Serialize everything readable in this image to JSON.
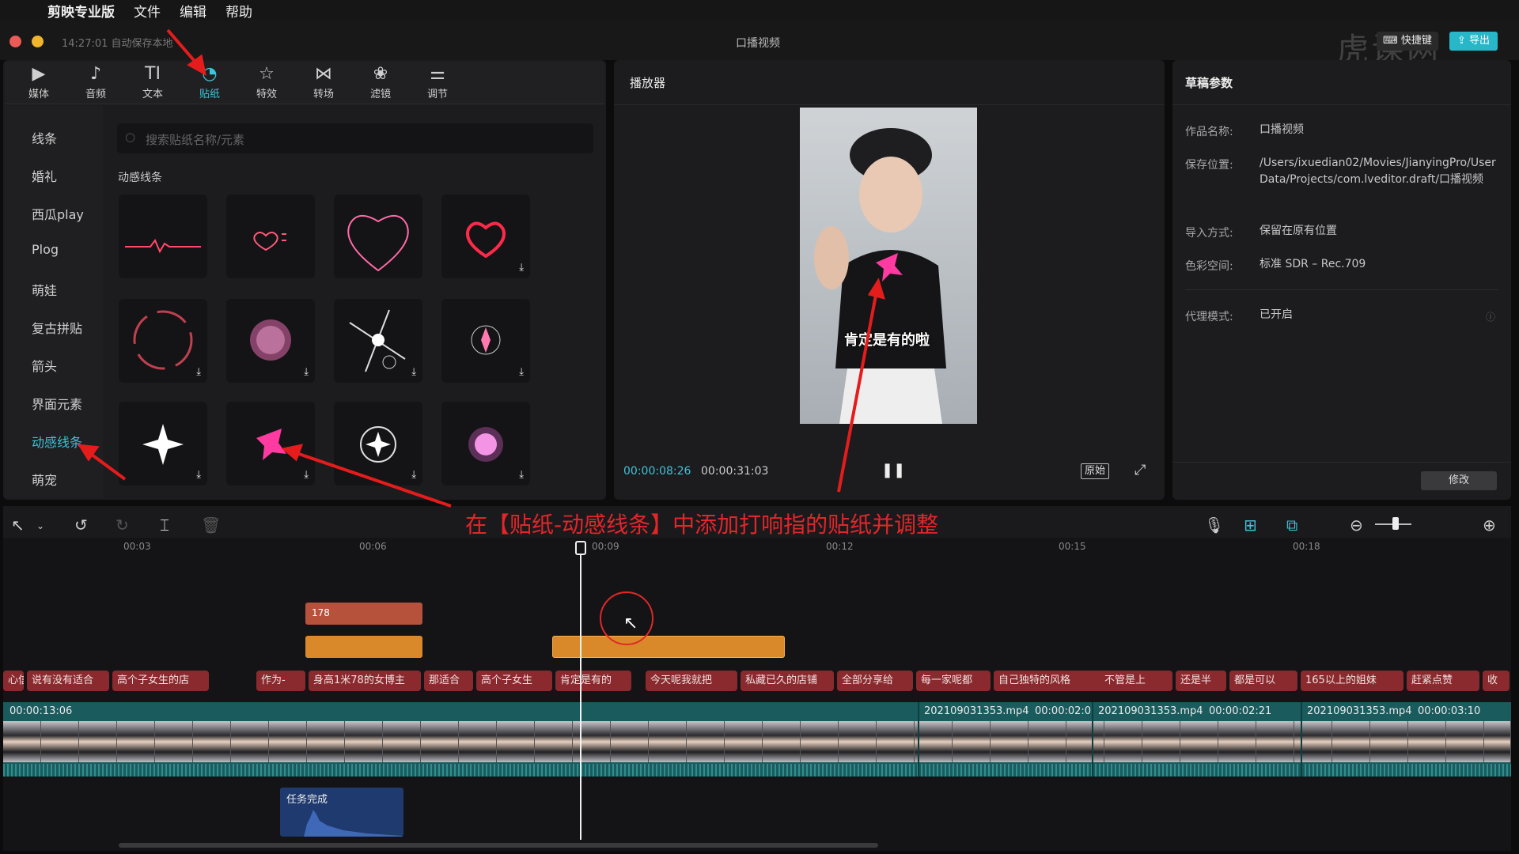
{
  "menubar": {
    "app": "剪映专业版",
    "file": "文件",
    "edit": "编辑",
    "help": "帮助"
  },
  "titlebar": {
    "autosave": "14:27:01 自动保存本地",
    "title": "口播视频",
    "shortcut": "快捷键",
    "export": "导出",
    "watermark": "虎课网"
  },
  "toolbar": [
    {
      "label": "媒体",
      "icon": "media-icon"
    },
    {
      "label": "音频",
      "icon": "audio-icon"
    },
    {
      "label": "文本",
      "icon": "text-icon"
    },
    {
      "label": "贴纸",
      "icon": "sticker-icon"
    },
    {
      "label": "特效",
      "icon": "effects-icon"
    },
    {
      "label": "转场",
      "icon": "transition-icon"
    },
    {
      "label": "滤镜",
      "icon": "filter-icon"
    },
    {
      "label": "调节",
      "icon": "adjust-icon"
    }
  ],
  "categories": [
    "线条",
    "婚礼",
    "西瓜play",
    "Plog",
    "萌娃",
    "复古拼贴",
    "箭头",
    "界面元素",
    "动感线条",
    "萌宠"
  ],
  "search": {
    "placeholder": "搜索贴纸名称/元素"
  },
  "section_title": "动感线条",
  "player": {
    "title": "播放器",
    "current_time": "00:00:08:26",
    "total_time": "00:00:31:03",
    "original_label": "原始",
    "subtitle": "肯定是有的啦"
  },
  "draft": {
    "title": "草稿参数",
    "rows": [
      {
        "label": "作品名称:",
        "value": "口播视频"
      },
      {
        "label": "保存位置:",
        "value": "/Users/ixuedian02/Movies/JianyingPro/User Data/Projects/com.lveditor.draft/口播视频"
      },
      {
        "label": "导入方式:",
        "value": "保留在原有位置"
      },
      {
        "label": "色彩空间:",
        "value": "标准 SDR – Rec.709"
      },
      {
        "label": "代理模式:",
        "value": "已开启"
      }
    ],
    "modify_button": "修改"
  },
  "annotation": "在【贴纸-动感线条】中添加打响指的贴纸并调整",
  "ruler": [
    "00:03",
    "00:06",
    "00:09",
    "00:12",
    "00:15",
    "00:18"
  ],
  "tracks": {
    "sticker_clip_label": "178",
    "captions": [
      "心信旧",
      "说有没有适合",
      "高个子女生的店",
      "作为-",
      "身高1米78的女博主",
      "那适合",
      "高个子女生",
      "肯定是有的",
      "今天呢我就把",
      "私藏已久的店铺",
      "全部分享给",
      "每一家呢都",
      "自己独特的风格",
      "不管是上",
      "还是半",
      "都是可以",
      "165以上的姐妹",
      "赶紧点赞",
      "收"
    ],
    "video_duration": "00:00:13:06",
    "clips": [
      {
        "name": "202109031353.mp4",
        "duration": "00:00:02:0"
      },
      {
        "name": "202109031353.mp4",
        "duration": "00:00:02:21"
      },
      {
        "name": "202109031353.mp4",
        "duration": "00:00:03:10"
      }
    ],
    "audio_label": "任务完成"
  }
}
